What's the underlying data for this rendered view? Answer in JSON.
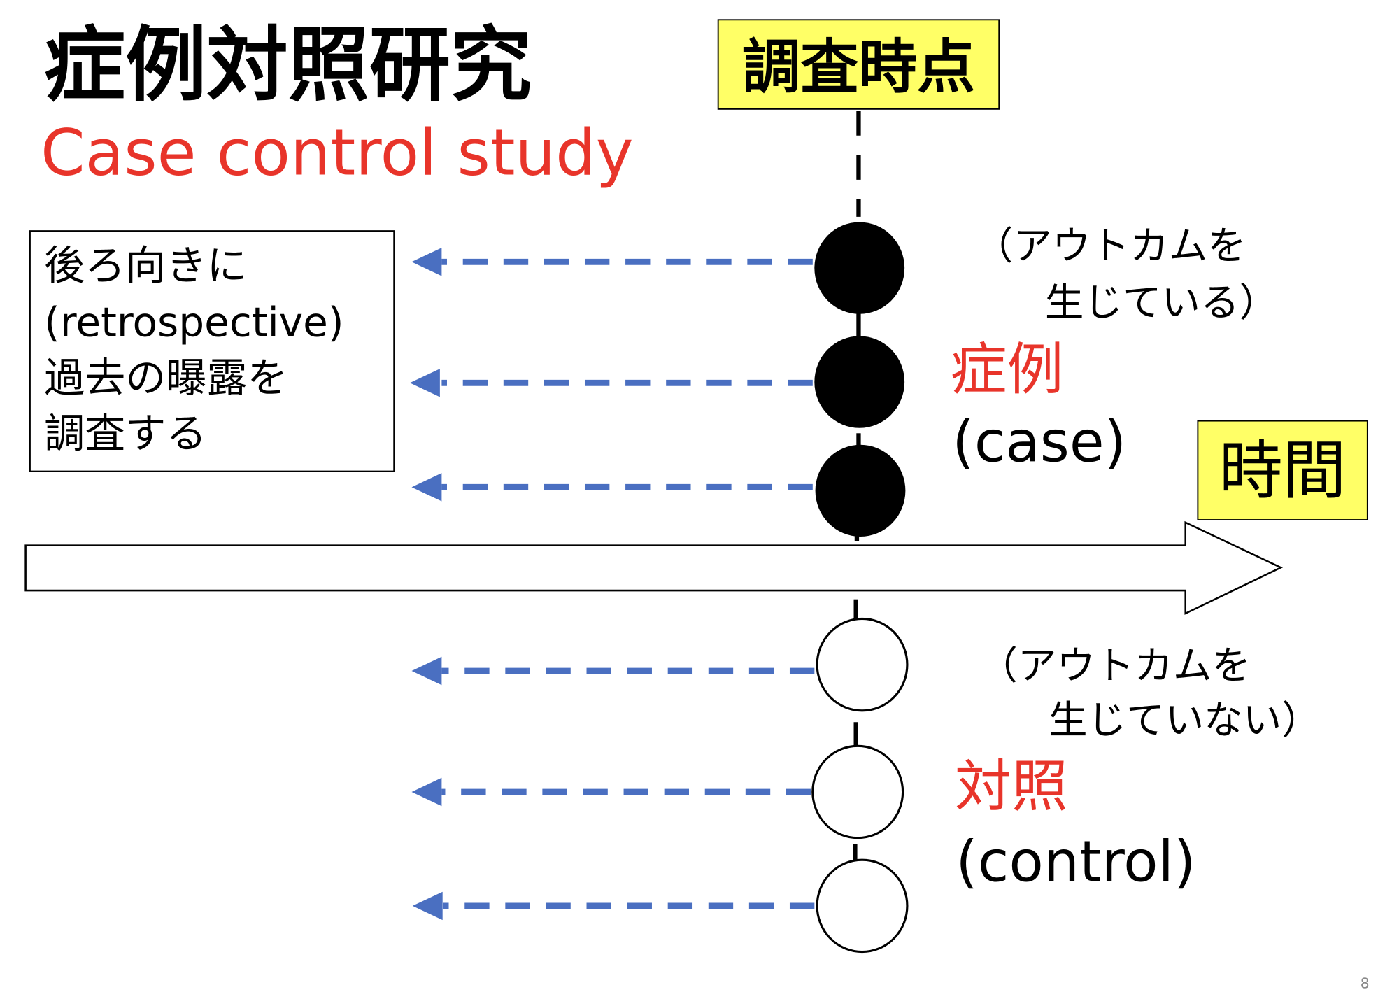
{
  "title": "症例対照研究",
  "subtitle": "Case control study",
  "survey_point_label": "調査時点",
  "time_label": "時間",
  "retrospective_box": {
    "lines": [
      "後ろ向きに",
      "(retrospective)",
      "過去の曝露を",
      "調査する"
    ]
  },
  "case_group": {
    "outcome_line1": "（アウトカムを",
    "outcome_line2": "生じている）",
    "label_ja": "症例",
    "label_en": "(case)"
  },
  "control_group": {
    "outcome_line1": "（アウトカムを",
    "outcome_line2": "生じていない）",
    "label_ja": "対照",
    "label_en": "(control)"
  },
  "page_number": "8",
  "colors": {
    "accent_red": "#e8342a",
    "highlight_yellow": "#ffff66",
    "arrow_blue": "#4a6fc1"
  }
}
